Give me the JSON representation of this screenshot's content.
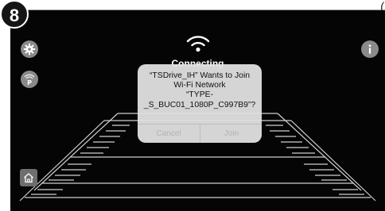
{
  "step_number": "8",
  "status": {
    "label": "Connecting"
  },
  "alert": {
    "message_lines": [
      "“TSDrive_IH” Wants to Join",
      "Wi-Fi Network",
      "“TYPE-",
      "_S_BUC01_1080P_C997B9”?"
    ],
    "cancel_label": "Cancel",
    "join_label": "Join"
  },
  "icons": {
    "settings": "gear-icon",
    "parking": "parking-icon",
    "info": "info-icon",
    "home": "home-icon",
    "wifi": "wifi-icon"
  },
  "colors": {
    "screen_bg": "#050505",
    "button_gray": "#8a8a8a",
    "alert_bg": "#e2e2e2",
    "guide_lines": "#d0d0d0"
  }
}
